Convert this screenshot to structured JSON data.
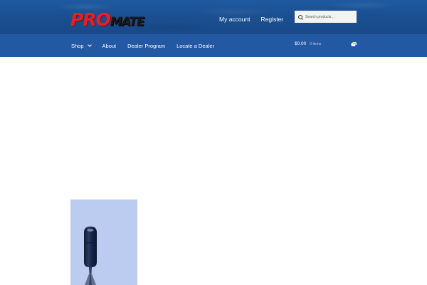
{
  "header": {
    "logo": {
      "part1": "PRO",
      "part2": "MATE"
    },
    "account_links": [
      {
        "label": "My account"
      },
      {
        "label": "Register"
      }
    ],
    "search": {
      "placeholder": "Search products…",
      "value": ""
    }
  },
  "nav": {
    "items": [
      {
        "label": "Shop",
        "has_dropdown": true
      },
      {
        "label": "About"
      },
      {
        "label": "Dealer Program"
      },
      {
        "label": "Locate a Dealer"
      }
    ]
  },
  "cart": {
    "total": "$0.00",
    "items": "0 items",
    "icon": "basket-icon"
  },
  "colors": {
    "header_bg": "#1f5aa0",
    "nav_bg": "#2358a3",
    "logo_red": "#e1202a",
    "product_bg": "#bccbf0"
  }
}
